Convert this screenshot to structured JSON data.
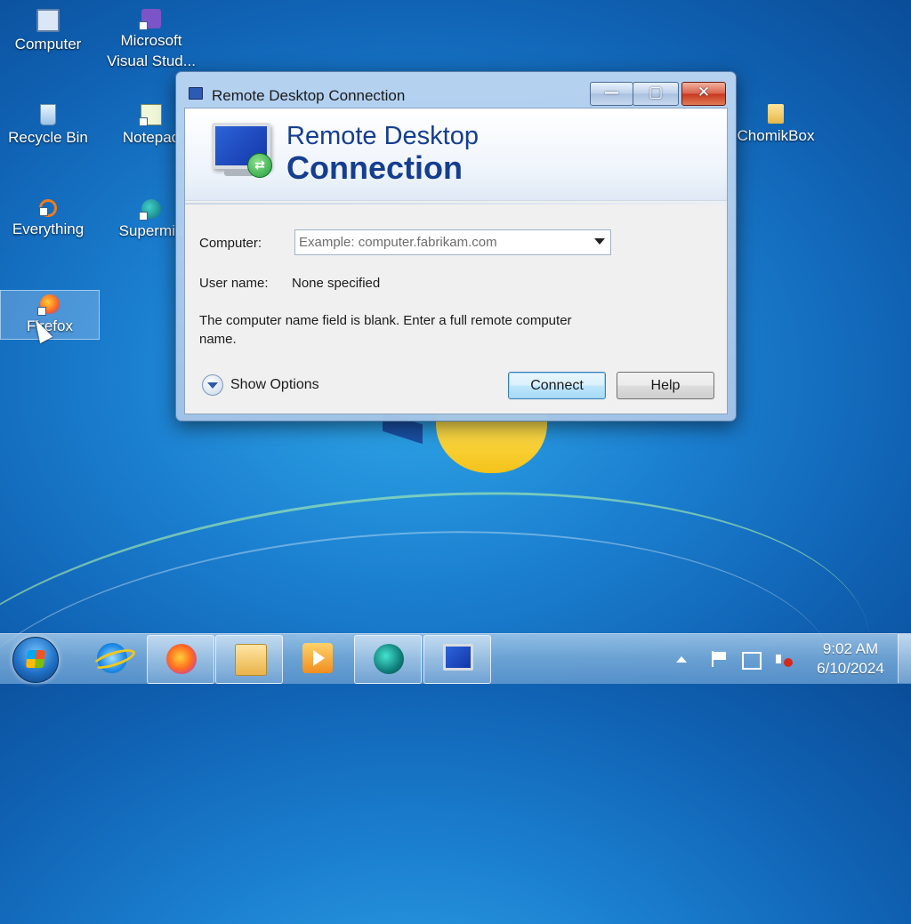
{
  "desktop": {
    "icons": [
      {
        "label": "Computer",
        "icon": "computer-icon"
      },
      {
        "label": "Microsoft\nVisual Stud...",
        "icon": "visual-studio-icon"
      },
      {
        "label": "Recycle Bin",
        "icon": "recycle-bin-icon"
      },
      {
        "label": "Notepad",
        "icon": "notepad-icon"
      },
      {
        "label": "Everything",
        "icon": "everything-search-icon"
      },
      {
        "label": "Supermiu",
        "icon": "supermium-icon"
      },
      {
        "label": "Firefox",
        "icon": "firefox-icon"
      },
      {
        "label": "ChomikBox",
        "icon": "folder-icon"
      }
    ]
  },
  "dialog": {
    "title": "Remote Desktop Connection",
    "banner_line1": "Remote Desktop",
    "banner_line2": "Connection",
    "computer_label": "Computer:",
    "computer_placeholder": "Example: computer.fabrikam.com",
    "computer_value": "",
    "username_label": "User name:",
    "username_value": "None specified",
    "message": "The computer name field is blank. Enter a full remote computer name.",
    "show_options_label": "Show Options",
    "connect_label": "Connect",
    "help_label": "Help",
    "minimize_glyph": "—",
    "maximize_glyph": "▢",
    "close_glyph": "✕"
  },
  "taskbar": {
    "pinned": [
      "internet-explorer-icon",
      "firefox-icon",
      "windows-explorer-icon",
      "media-player-icon",
      "supermium-icon",
      "remote-desktop-icon"
    ],
    "clock_time": "9:02 AM",
    "clock_date": "6/10/2024"
  },
  "colors": {
    "banner_title": "#153e8f",
    "close_button": "#c8381f",
    "default_button_border": "#3c7fb1"
  }
}
